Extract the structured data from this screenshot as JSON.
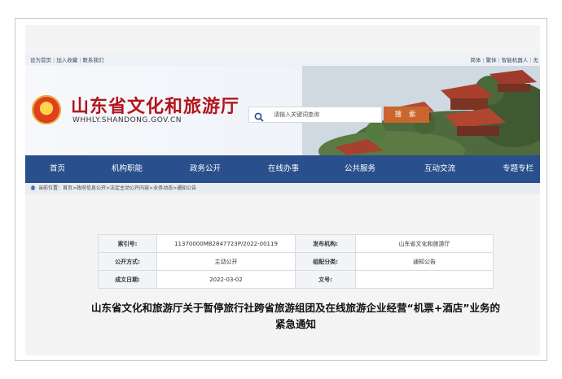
{
  "topbar": {
    "left_links": [
      "设为首页",
      "加入收藏",
      "联系我们"
    ],
    "right_links": [
      "简体",
      "繁体",
      "智能机器人",
      "无"
    ]
  },
  "header": {
    "site_title": "山东省文化和旅游厅",
    "domain": "WHHLY.SHANDONG.GOV.CN",
    "search_placeholder": "请输入关键词查询",
    "search_button": "搜 索"
  },
  "nav": {
    "items": [
      "首页",
      "机构职能",
      "政务公开",
      "在线办事",
      "公共服务",
      "互动交流",
      "专题专栏"
    ]
  },
  "breadcrumb": {
    "text": "当前位置：首页>政府信息公开>法定主动公开内容>业务动态>通知公告"
  },
  "info_table": {
    "rows": [
      {
        "k1": "索引号:",
        "v1": "11370000MB2847723P/2022-00119",
        "k2": "发布机构:",
        "v2": "山东省文化和旅游厅"
      },
      {
        "k1": "公开方式:",
        "v1": "主动公开",
        "k2": "组配分类:",
        "v2": "通知公告"
      },
      {
        "k1": "成文日期:",
        "v1": "2022-03-02",
        "k2": "文号:",
        "v2": ""
      }
    ]
  },
  "document": {
    "title": "山东省文化和旅游厅关于暂停旅行社跨省旅游组团及在线旅游企业经营“机票+酒店”业务的紧急通知"
  },
  "colors": {
    "nav_bg": "#294f8c",
    "title_red": "#b1161c",
    "search_btn": "#c9652d"
  }
}
